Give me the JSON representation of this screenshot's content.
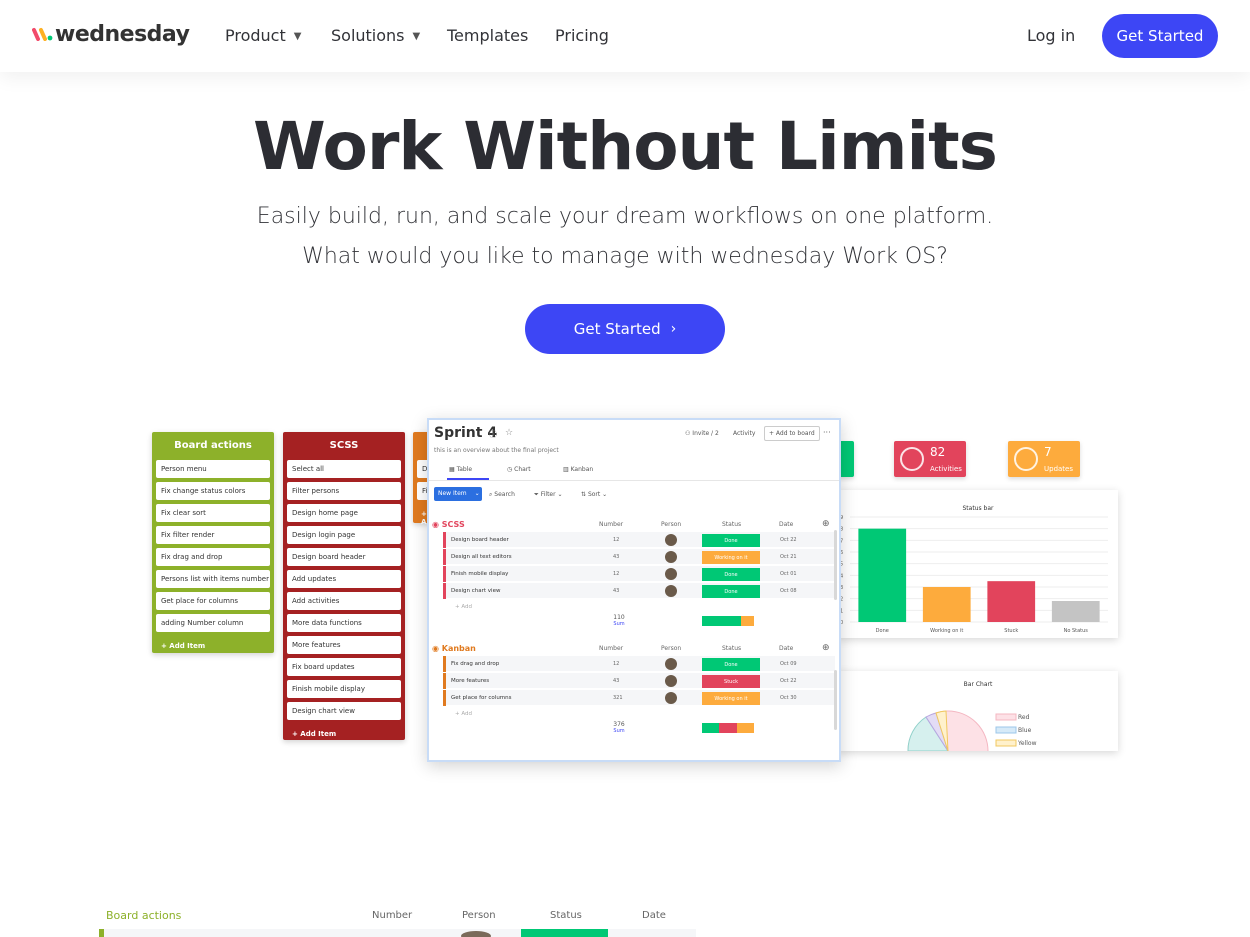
{
  "nav": {
    "brand": "wednesday",
    "items": [
      "Product",
      "Solutions",
      "Templates",
      "Pricing"
    ],
    "login": "Log in",
    "cta": "Get Started"
  },
  "hero": {
    "title": "Work Without Limits",
    "subtitle_1": "Easily build, run, and scale your dream workflows on one platform.",
    "subtitle_2": "What would you like to manage with wednesday Work OS?",
    "cta": "Get Started"
  },
  "kanban": {
    "board_actions": {
      "title": "Board actions",
      "color": "#8db12a",
      "cards": [
        "Person menu",
        "Fix change status colors",
        "Fix clear sort",
        "Fix filter render",
        "Fix drag and drop",
        "Persons list with items number",
        "Get place for columns",
        "adding Number column"
      ],
      "add": "+ Add Item"
    },
    "scss": {
      "title": "SCSS",
      "color": "#a52122",
      "cards": [
        "Select all",
        "Filter persons",
        "Design home page",
        "Design login page",
        "Design board header",
        "Add updates",
        "Add activities",
        "More data functions",
        "More features",
        "Fix board updates",
        "Finish mobile display",
        "Design chart view"
      ],
      "add": "+ Add Item"
    },
    "kanban_col": {
      "color": "#e07a1f",
      "cards": [
        "De",
        "Fix"
      ],
      "add": "+ A"
    }
  },
  "board": {
    "title": "Sprint 4",
    "subtitle": "this is an overview about the final project",
    "invite": "Invite / 2",
    "activity": "Activity",
    "add_to_board": "+ Add to board",
    "more": "···",
    "tabs": [
      "Table",
      "Chart",
      "Kanban"
    ],
    "new_item": "New Item",
    "tools": [
      "Search",
      "Filter",
      "Sort"
    ],
    "columns": [
      "Number",
      "Person",
      "Status",
      "Date"
    ],
    "groups": [
      {
        "name": "SCSS",
        "color": "#e2445c",
        "rows": [
          {
            "name": "Design board header",
            "number": "12",
            "status": "Done",
            "status_color": "#00c875",
            "date": "Oct 22"
          },
          {
            "name": "Design all text editors",
            "number": "43",
            "status": "Working on it",
            "status_color": "#fdab3d",
            "date": "Oct 21"
          },
          {
            "name": "Finish mobile display",
            "number": "12",
            "status": "Done",
            "status_color": "#00c875",
            "date": "Oct 01"
          },
          {
            "name": "Design chart view",
            "number": "43",
            "status": "Done",
            "status_color": "#00c875",
            "date": "Oct 08"
          }
        ],
        "add": "+ Add",
        "sum_value": "110",
        "sum_label": "Sum"
      },
      {
        "name": "Kanban",
        "color": "#e07a1f",
        "rows": [
          {
            "name": "Fix drag and drop",
            "number": "12",
            "status": "Done",
            "status_color": "#00c875",
            "date": "Oct 09"
          },
          {
            "name": "More features",
            "number": "43",
            "status": "Stuck",
            "status_color": "#e2445c",
            "date": "Oct 22"
          },
          {
            "name": "Get place for columns",
            "number": "321",
            "status": "Working on it",
            "status_color": "#fdab3d",
            "date": "Oct 30"
          }
        ],
        "add": "+ Add",
        "sum_value": "376",
        "sum_label": "Sum"
      }
    ]
  },
  "widgets": {
    "stats": [
      {
        "value": "82",
        "label": "Activities",
        "color": "#e2445c",
        "icon": "activity-icon"
      },
      {
        "value": "7",
        "label": "Updates",
        "color": "#fdab3d",
        "icon": "chat-icon"
      }
    ],
    "status_bar": {
      "title": "Status bar",
      "chart_data": {
        "type": "bar",
        "categories": [
          "Done",
          "Working on it",
          "Stuck",
          "No Status"
        ],
        "values": [
          8,
          3,
          3.5,
          1.8
        ],
        "colors": [
          "#00c875",
          "#fdab3d",
          "#e2445c",
          "#c4c4c4"
        ],
        "y_ticks": [
          0,
          1,
          2,
          3,
          4,
          5,
          6,
          7,
          8,
          9
        ],
        "ylim": [
          0,
          9
        ]
      }
    },
    "bar_chart": {
      "title": "Bar Chart",
      "legend": [
        "Red",
        "Blue",
        "Yellow"
      ]
    }
  },
  "bottom": {
    "title": "Board actions",
    "columns": [
      "Number",
      "Person",
      "Status",
      "Date"
    ]
  }
}
